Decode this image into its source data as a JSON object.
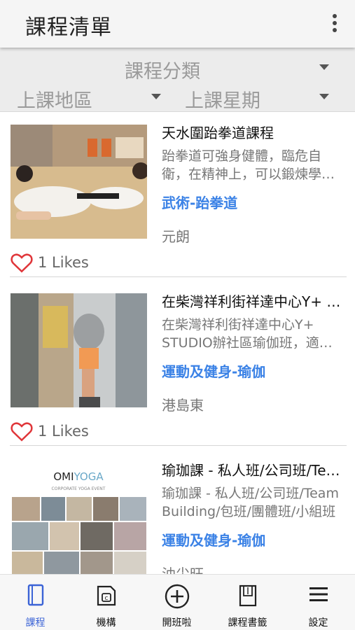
{
  "appbar": {
    "title": "課程清單",
    "more_icon": "more-vert-icon"
  },
  "filters": {
    "category": "課程分類",
    "area": "上課地區",
    "weekday": "上課星期"
  },
  "courses": [
    {
      "title": "天水圍跆拳道課程",
      "description": "跆拳道可強身健體，臨危自衛，在精神上，可以鍛煉學生的意志",
      "category": "武術-跆拳道",
      "area": "元朗",
      "likes": "1 Likes"
    },
    {
      "title": "在柴灣祥利街祥達中心Y+ STUDIO瑜伽班",
      "description": "在柴灣祥利街祥達中心Y+ STUDIO辦社區瑜伽班，適合初學者參加",
      "category": "運動及健身-瑜伽",
      "area": "港島東",
      "likes": "1 Likes"
    },
    {
      "title": "瑜珈課 - 私人班/公司班/Team Building",
      "description": "瑜珈課 - 私人班/公司班/Team Building/包班/團體班/小組班",
      "category": "運動及健身-瑜伽",
      "area": "油尖旺",
      "logo": {
        "brand_a": "OMI",
        "brand_b": "YOGA",
        "tagline": "CORPORATE YOGA EVENT"
      }
    }
  ],
  "bottom_nav": [
    {
      "label": "課程",
      "icon": "book-icon",
      "active": true
    },
    {
      "label": "機構",
      "icon": "organization-icon",
      "active": false
    },
    {
      "label": "開班啦",
      "icon": "add-circle-icon",
      "active": false
    },
    {
      "label": "課程書籤",
      "icon": "bookmark-icon",
      "active": false
    },
    {
      "label": "設定",
      "icon": "menu-icon",
      "active": false
    }
  ],
  "colors": {
    "accent": "#3b82e6",
    "nav_active": "#3b63d6",
    "heart": "#e0363a"
  }
}
